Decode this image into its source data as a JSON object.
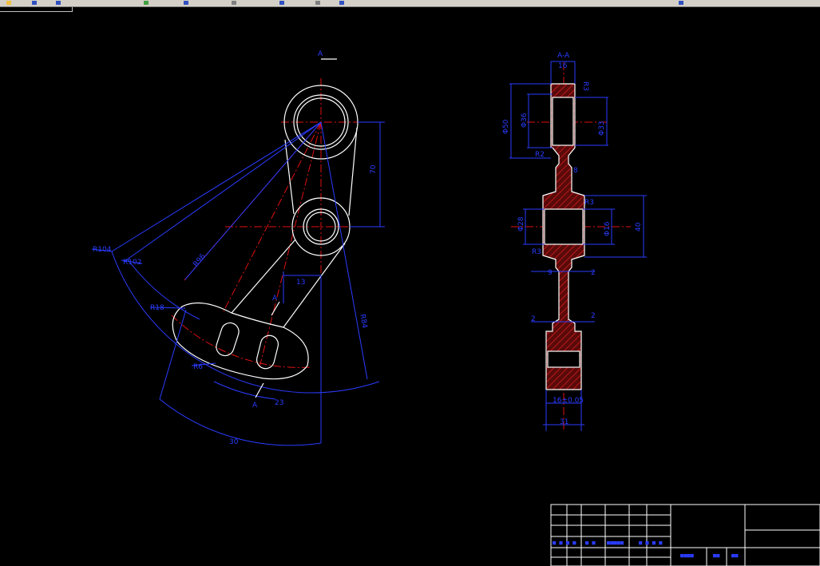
{
  "toolbar": {
    "icons": [
      "toolbar-icon-1",
      "toolbar-icon-2",
      "toolbar-icon-3",
      "toolbar-icon-4",
      "toolbar-icon-5",
      "toolbar-icon-6",
      "toolbar-icon-7",
      "toolbar-icon-8",
      "toolbar-icon-9",
      "toolbar-icon-10"
    ]
  },
  "colors": {
    "background": "#000000",
    "geometry": "#ffffff",
    "dimension": "#2a3cff",
    "centerline": "#e01010",
    "hatch": "#c01a1a"
  },
  "front_view": {
    "section_mark_top": "A",
    "section_mark_mid": "A",
    "section_mark_bottom": "A",
    "dims": {
      "r104": "R104",
      "r102": "R102",
      "r96": "R96",
      "r18": "R18",
      "r6": "R6",
      "d70": "70",
      "d13": "13",
      "d23": "23",
      "d30": "30",
      "d84": "R84"
    }
  },
  "section_view": {
    "title": "A-A",
    "dims": {
      "w16": "16",
      "r3_top": "R3",
      "dia50": "Φ50",
      "dia36": "Φ36",
      "dia33": "Φ33",
      "r2a": "R2",
      "d8": "8",
      "d28": "Φ28",
      "r3_mid": "R3",
      "r3_low": "R3",
      "d16f": "Φ16",
      "d40": "40",
      "d9": "9",
      "d2a": "2",
      "d2b": "2",
      "d2c": "2",
      "d16_05": "16±0.05",
      "d31": "31"
    }
  },
  "title_block": {
    "row_labels": [
      "■ ■ ■ ■",
      "■ ■",
      "■■■■■",
      "■ ■ ■ ■"
    ],
    "name_cells": [
      "■■■■",
      "■■",
      "■■"
    ]
  }
}
